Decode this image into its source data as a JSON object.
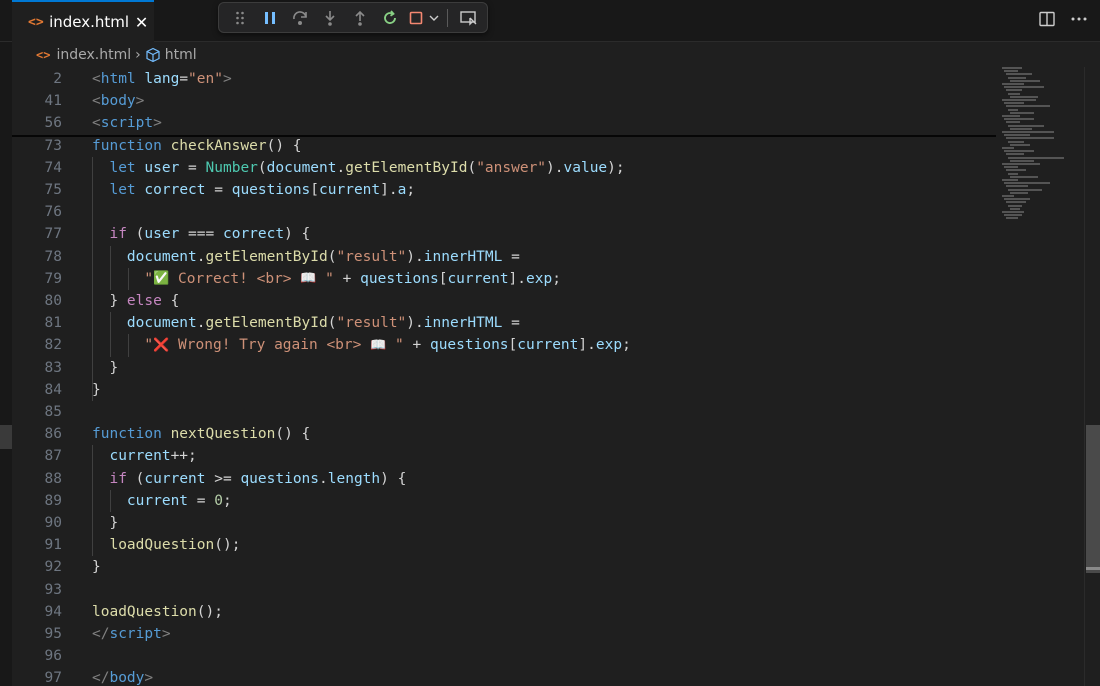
{
  "tab": {
    "label": "index.html",
    "icon": "html-file-icon",
    "close": "✕"
  },
  "debug_toolbar": {
    "buttons": [
      "drag-handle-icon",
      "pause-icon",
      "step-over-icon",
      "step-into-icon",
      "step-out-icon",
      "restart-icon",
      "stop-icon",
      "chevron-down-icon",
      "inspect-icon"
    ]
  },
  "top_right": [
    "split-editor-icon",
    "more-actions-icon"
  ],
  "breadcrumb": {
    "file": "index.html",
    "separator": "›",
    "symbol": "html"
  },
  "colors": {
    "accent": "#0078d4",
    "html_icon": "#e37933",
    "restart": "#89d185",
    "stop": "#f48771",
    "debug_blue": "#75beff"
  },
  "lines": [
    {
      "n": "2",
      "t": [
        [
          "tk-brk",
          "<"
        ],
        [
          "tk-tag",
          "html"
        ],
        [
          "tk-p",
          " "
        ],
        [
          "tk-attr",
          "lang"
        ],
        [
          "tk-p",
          "="
        ],
        [
          "tk-str",
          "\"en\""
        ],
        [
          "tk-brk",
          ">"
        ]
      ]
    },
    {
      "n": "41",
      "t": [
        [
          "tk-brk",
          "<"
        ],
        [
          "tk-tag",
          "body"
        ],
        [
          "tk-brk",
          ">"
        ]
      ]
    },
    {
      "n": "56",
      "t": [
        [
          "tk-brk",
          "<"
        ],
        [
          "tk-tag",
          "script"
        ],
        [
          "tk-brk",
          ">"
        ]
      ]
    },
    {
      "n": "73",
      "t": [
        [
          "tk-kw",
          "function"
        ],
        [
          "tk-p",
          " "
        ],
        [
          "tk-fn",
          "checkAnswer"
        ],
        [
          "tk-p",
          "() {"
        ]
      ]
    },
    {
      "n": "74",
      "t": [
        [
          "tk-p",
          "  "
        ],
        [
          "tk-kw",
          "let"
        ],
        [
          "tk-p",
          " "
        ],
        [
          "tk-var",
          "user"
        ],
        [
          "tk-p",
          " = "
        ],
        [
          "tk-cls",
          "Number"
        ],
        [
          "tk-p",
          "("
        ],
        [
          "tk-var",
          "document"
        ],
        [
          "tk-p",
          "."
        ],
        [
          "tk-fn",
          "getElementById"
        ],
        [
          "tk-p",
          "("
        ],
        [
          "tk-str",
          "\"answer\""
        ],
        [
          "tk-p",
          ")."
        ],
        [
          "tk-var",
          "value"
        ],
        [
          "tk-p",
          ");"
        ]
      ]
    },
    {
      "n": "75",
      "t": [
        [
          "tk-p",
          "  "
        ],
        [
          "tk-kw",
          "let"
        ],
        [
          "tk-p",
          " "
        ],
        [
          "tk-var",
          "correct"
        ],
        [
          "tk-p",
          " = "
        ],
        [
          "tk-var",
          "questions"
        ],
        [
          "tk-p",
          "["
        ],
        [
          "tk-var",
          "current"
        ],
        [
          "tk-p",
          "]."
        ],
        [
          "tk-var",
          "a"
        ],
        [
          "tk-p",
          ";"
        ]
      ]
    },
    {
      "n": "76",
      "t": []
    },
    {
      "n": "77",
      "t": [
        [
          "tk-p",
          "  "
        ],
        [
          "tk-ctl",
          "if"
        ],
        [
          "tk-p",
          " ("
        ],
        [
          "tk-var",
          "user"
        ],
        [
          "tk-p",
          " === "
        ],
        [
          "tk-var",
          "correct"
        ],
        [
          "tk-p",
          ") {"
        ]
      ]
    },
    {
      "n": "78",
      "t": [
        [
          "tk-p",
          "    "
        ],
        [
          "tk-var",
          "document"
        ],
        [
          "tk-p",
          "."
        ],
        [
          "tk-fn",
          "getElementById"
        ],
        [
          "tk-p",
          "("
        ],
        [
          "tk-str",
          "\"result\""
        ],
        [
          "tk-p",
          ")."
        ],
        [
          "tk-var",
          "innerHTML"
        ],
        [
          "tk-p",
          " ="
        ]
      ]
    },
    {
      "n": "79",
      "t": [
        [
          "tk-p",
          "      "
        ],
        [
          "tk-str",
          "\""
        ],
        [
          "tk-emo",
          "✅"
        ],
        [
          "tk-str",
          " Correct! <br> "
        ],
        [
          "tk-emo",
          "📖"
        ],
        [
          "tk-str",
          " \""
        ],
        [
          "tk-p",
          " + "
        ],
        [
          "tk-var",
          "questions"
        ],
        [
          "tk-p",
          "["
        ],
        [
          "tk-var",
          "current"
        ],
        [
          "tk-p",
          "]."
        ],
        [
          "tk-var",
          "exp"
        ],
        [
          "tk-p",
          ";"
        ]
      ]
    },
    {
      "n": "80",
      "t": [
        [
          "tk-p",
          "  } "
        ],
        [
          "tk-ctl",
          "else"
        ],
        [
          "tk-p",
          " {"
        ]
      ]
    },
    {
      "n": "81",
      "t": [
        [
          "tk-p",
          "    "
        ],
        [
          "tk-var",
          "document"
        ],
        [
          "tk-p",
          "."
        ],
        [
          "tk-fn",
          "getElementById"
        ],
        [
          "tk-p",
          "("
        ],
        [
          "tk-str",
          "\"result\""
        ],
        [
          "tk-p",
          ")."
        ],
        [
          "tk-var",
          "innerHTML"
        ],
        [
          "tk-p",
          " ="
        ]
      ]
    },
    {
      "n": "82",
      "t": [
        [
          "tk-p",
          "      "
        ],
        [
          "tk-str",
          "\""
        ],
        [
          "tk-emo",
          "❌"
        ],
        [
          "tk-str",
          " Wrong! Try again <br> "
        ],
        [
          "tk-emo",
          "📖"
        ],
        [
          "tk-str",
          " \""
        ],
        [
          "tk-p",
          " + "
        ],
        [
          "tk-var",
          "questions"
        ],
        [
          "tk-p",
          "["
        ],
        [
          "tk-var",
          "current"
        ],
        [
          "tk-p",
          "]."
        ],
        [
          "tk-var",
          "exp"
        ],
        [
          "tk-p",
          ";"
        ]
      ]
    },
    {
      "n": "83",
      "t": [
        [
          "tk-p",
          "  }"
        ]
      ]
    },
    {
      "n": "84",
      "t": [
        [
          "tk-p",
          "}"
        ]
      ]
    },
    {
      "n": "85",
      "t": []
    },
    {
      "n": "86",
      "t": [
        [
          "tk-kw",
          "function"
        ],
        [
          "tk-p",
          " "
        ],
        [
          "tk-fn",
          "nextQuestion"
        ],
        [
          "tk-p",
          "() {"
        ]
      ]
    },
    {
      "n": "87",
      "t": [
        [
          "tk-p",
          "  "
        ],
        [
          "tk-var",
          "current"
        ],
        [
          "tk-p",
          "++;"
        ]
      ]
    },
    {
      "n": "88",
      "t": [
        [
          "tk-p",
          "  "
        ],
        [
          "tk-ctl",
          "if"
        ],
        [
          "tk-p",
          " ("
        ],
        [
          "tk-var",
          "current"
        ],
        [
          "tk-p",
          " >= "
        ],
        [
          "tk-var",
          "questions"
        ],
        [
          "tk-p",
          "."
        ],
        [
          "tk-var",
          "length"
        ],
        [
          "tk-p",
          ") {"
        ]
      ]
    },
    {
      "n": "89",
      "t": [
        [
          "tk-p",
          "    "
        ],
        [
          "tk-var",
          "current"
        ],
        [
          "tk-p",
          " = "
        ],
        [
          "tk-num",
          "0"
        ],
        [
          "tk-p",
          ";"
        ]
      ]
    },
    {
      "n": "90",
      "t": [
        [
          "tk-p",
          "  }"
        ]
      ]
    },
    {
      "n": "91",
      "t": [
        [
          "tk-p",
          "  "
        ],
        [
          "tk-fn",
          "loadQuestion"
        ],
        [
          "tk-p",
          "();"
        ]
      ]
    },
    {
      "n": "92",
      "t": [
        [
          "tk-p",
          "}"
        ]
      ]
    },
    {
      "n": "93",
      "t": []
    },
    {
      "n": "94",
      "t": [
        [
          "tk-fn",
          "loadQuestion"
        ],
        [
          "tk-p",
          "();"
        ]
      ]
    },
    {
      "n": "95",
      "t": [
        [
          "tk-brk",
          "</"
        ],
        [
          "tk-tag",
          "script"
        ],
        [
          "tk-brk",
          ">"
        ]
      ]
    },
    {
      "n": "96",
      "t": []
    },
    {
      "n": "97",
      "t": [
        [
          "tk-brk",
          "</"
        ],
        [
          "tk-tag",
          "body"
        ],
        [
          "tk-brk",
          ">"
        ]
      ]
    }
  ]
}
